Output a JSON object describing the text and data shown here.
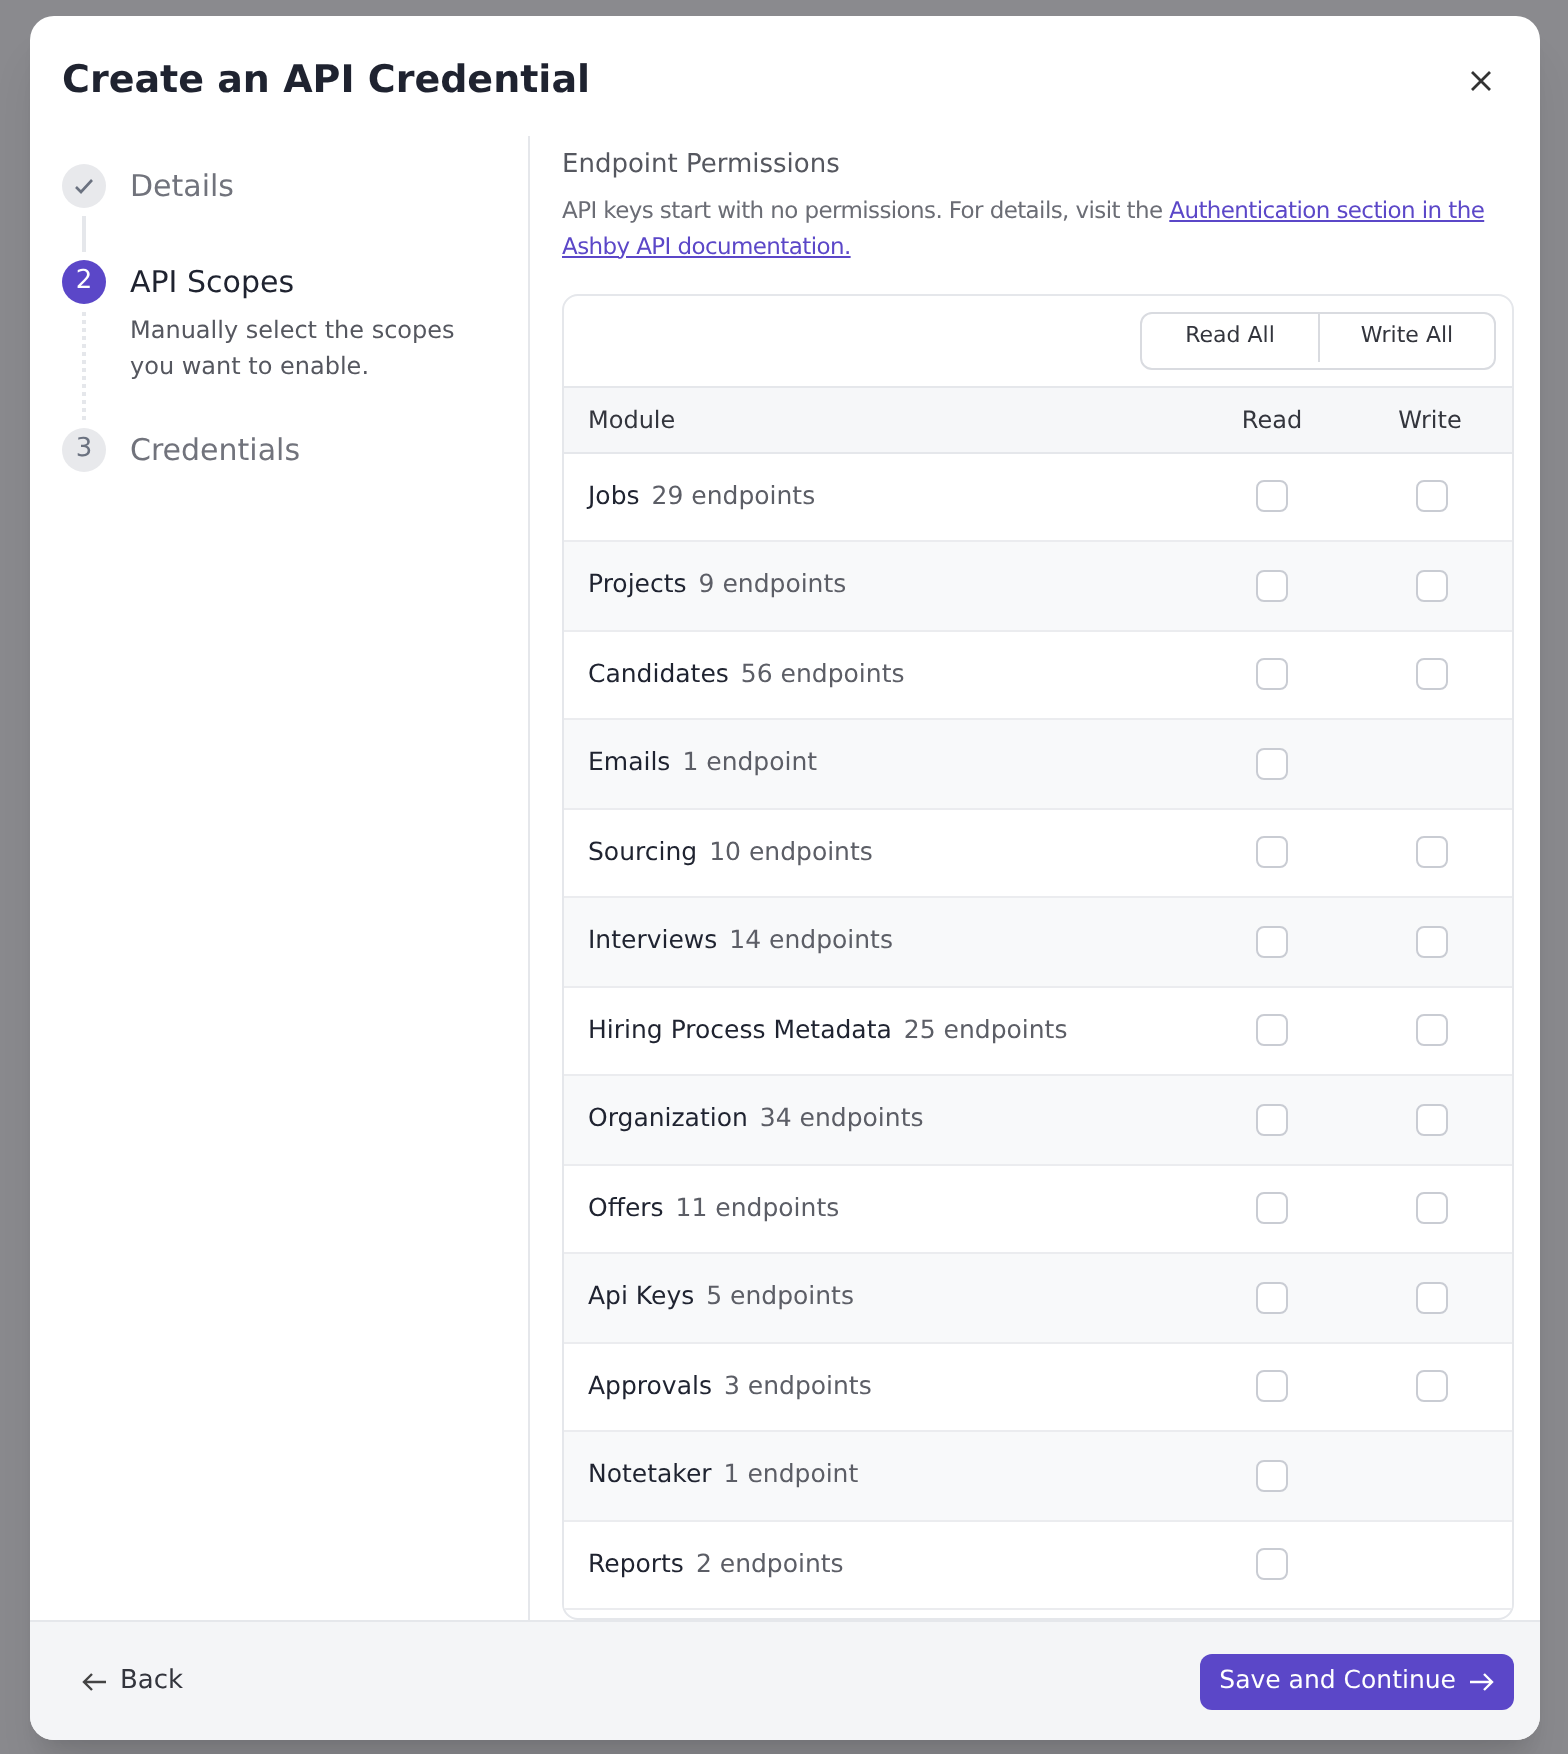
{
  "dialog": {
    "title": "Create an API Credential"
  },
  "steps": [
    {
      "label": "Details",
      "kind": "done"
    },
    {
      "number": "2",
      "label": "API Scopes",
      "kind": "current",
      "description": "Manually select the scopes you want to enable."
    },
    {
      "number": "3",
      "label": "Credentials",
      "kind": "todo"
    }
  ],
  "permissions": {
    "title": "Endpoint Permissions",
    "intro": "API keys start with no permissions. For details, visit the",
    "link_lines": [
      "Authentication section in the",
      "Ashby API documentation."
    ],
    "bulk_buttons": [
      "Read All",
      "Write All"
    ],
    "columns": [
      "Module",
      "Read",
      "Write"
    ],
    "rows": [
      {
        "module": "Jobs",
        "count": "29 endpoints",
        "read": {
          "checked": false
        },
        "write": {
          "checked": false
        }
      },
      {
        "module": "Projects",
        "count": "9 endpoints",
        "read": {
          "checked": false
        },
        "write": {
          "checked": false
        }
      },
      {
        "module": "Candidates",
        "count": "56 endpoints",
        "read": {
          "checked": false
        },
        "write": {
          "checked": false
        }
      },
      {
        "module": "Emails",
        "count": "1 endpoint",
        "read": {
          "checked": false
        }
      },
      {
        "module": "Sourcing",
        "count": "10 endpoints",
        "read": {
          "checked": false
        },
        "write": {
          "checked": false
        }
      },
      {
        "module": "Interviews",
        "count": "14 endpoints",
        "read": {
          "checked": false
        },
        "write": {
          "checked": false
        }
      },
      {
        "module": "Hiring Process Metadata",
        "count": "25 endpoints",
        "read": {
          "checked": false
        },
        "write": {
          "checked": false
        }
      },
      {
        "module": "Organization",
        "count": "34 endpoints",
        "read": {
          "checked": false
        },
        "write": {
          "checked": false
        }
      },
      {
        "module": "Offers",
        "count": "11 endpoints",
        "read": {
          "checked": false
        },
        "write": {
          "checked": false
        }
      },
      {
        "module": "Api Keys",
        "count": "5 endpoints",
        "read": {
          "checked": false
        },
        "write": {
          "checked": false
        }
      },
      {
        "module": "Approvals",
        "count": "3 endpoints",
        "read": {
          "checked": false
        },
        "write": {
          "checked": false
        }
      },
      {
        "module": "Notetaker",
        "count": "1 endpoint",
        "read": {
          "checked": false
        }
      },
      {
        "module": "Reports",
        "count": "2 endpoints",
        "read": {
          "checked": false
        }
      }
    ]
  },
  "footer": {
    "back": "Back",
    "primary": "Save and Continue"
  }
}
